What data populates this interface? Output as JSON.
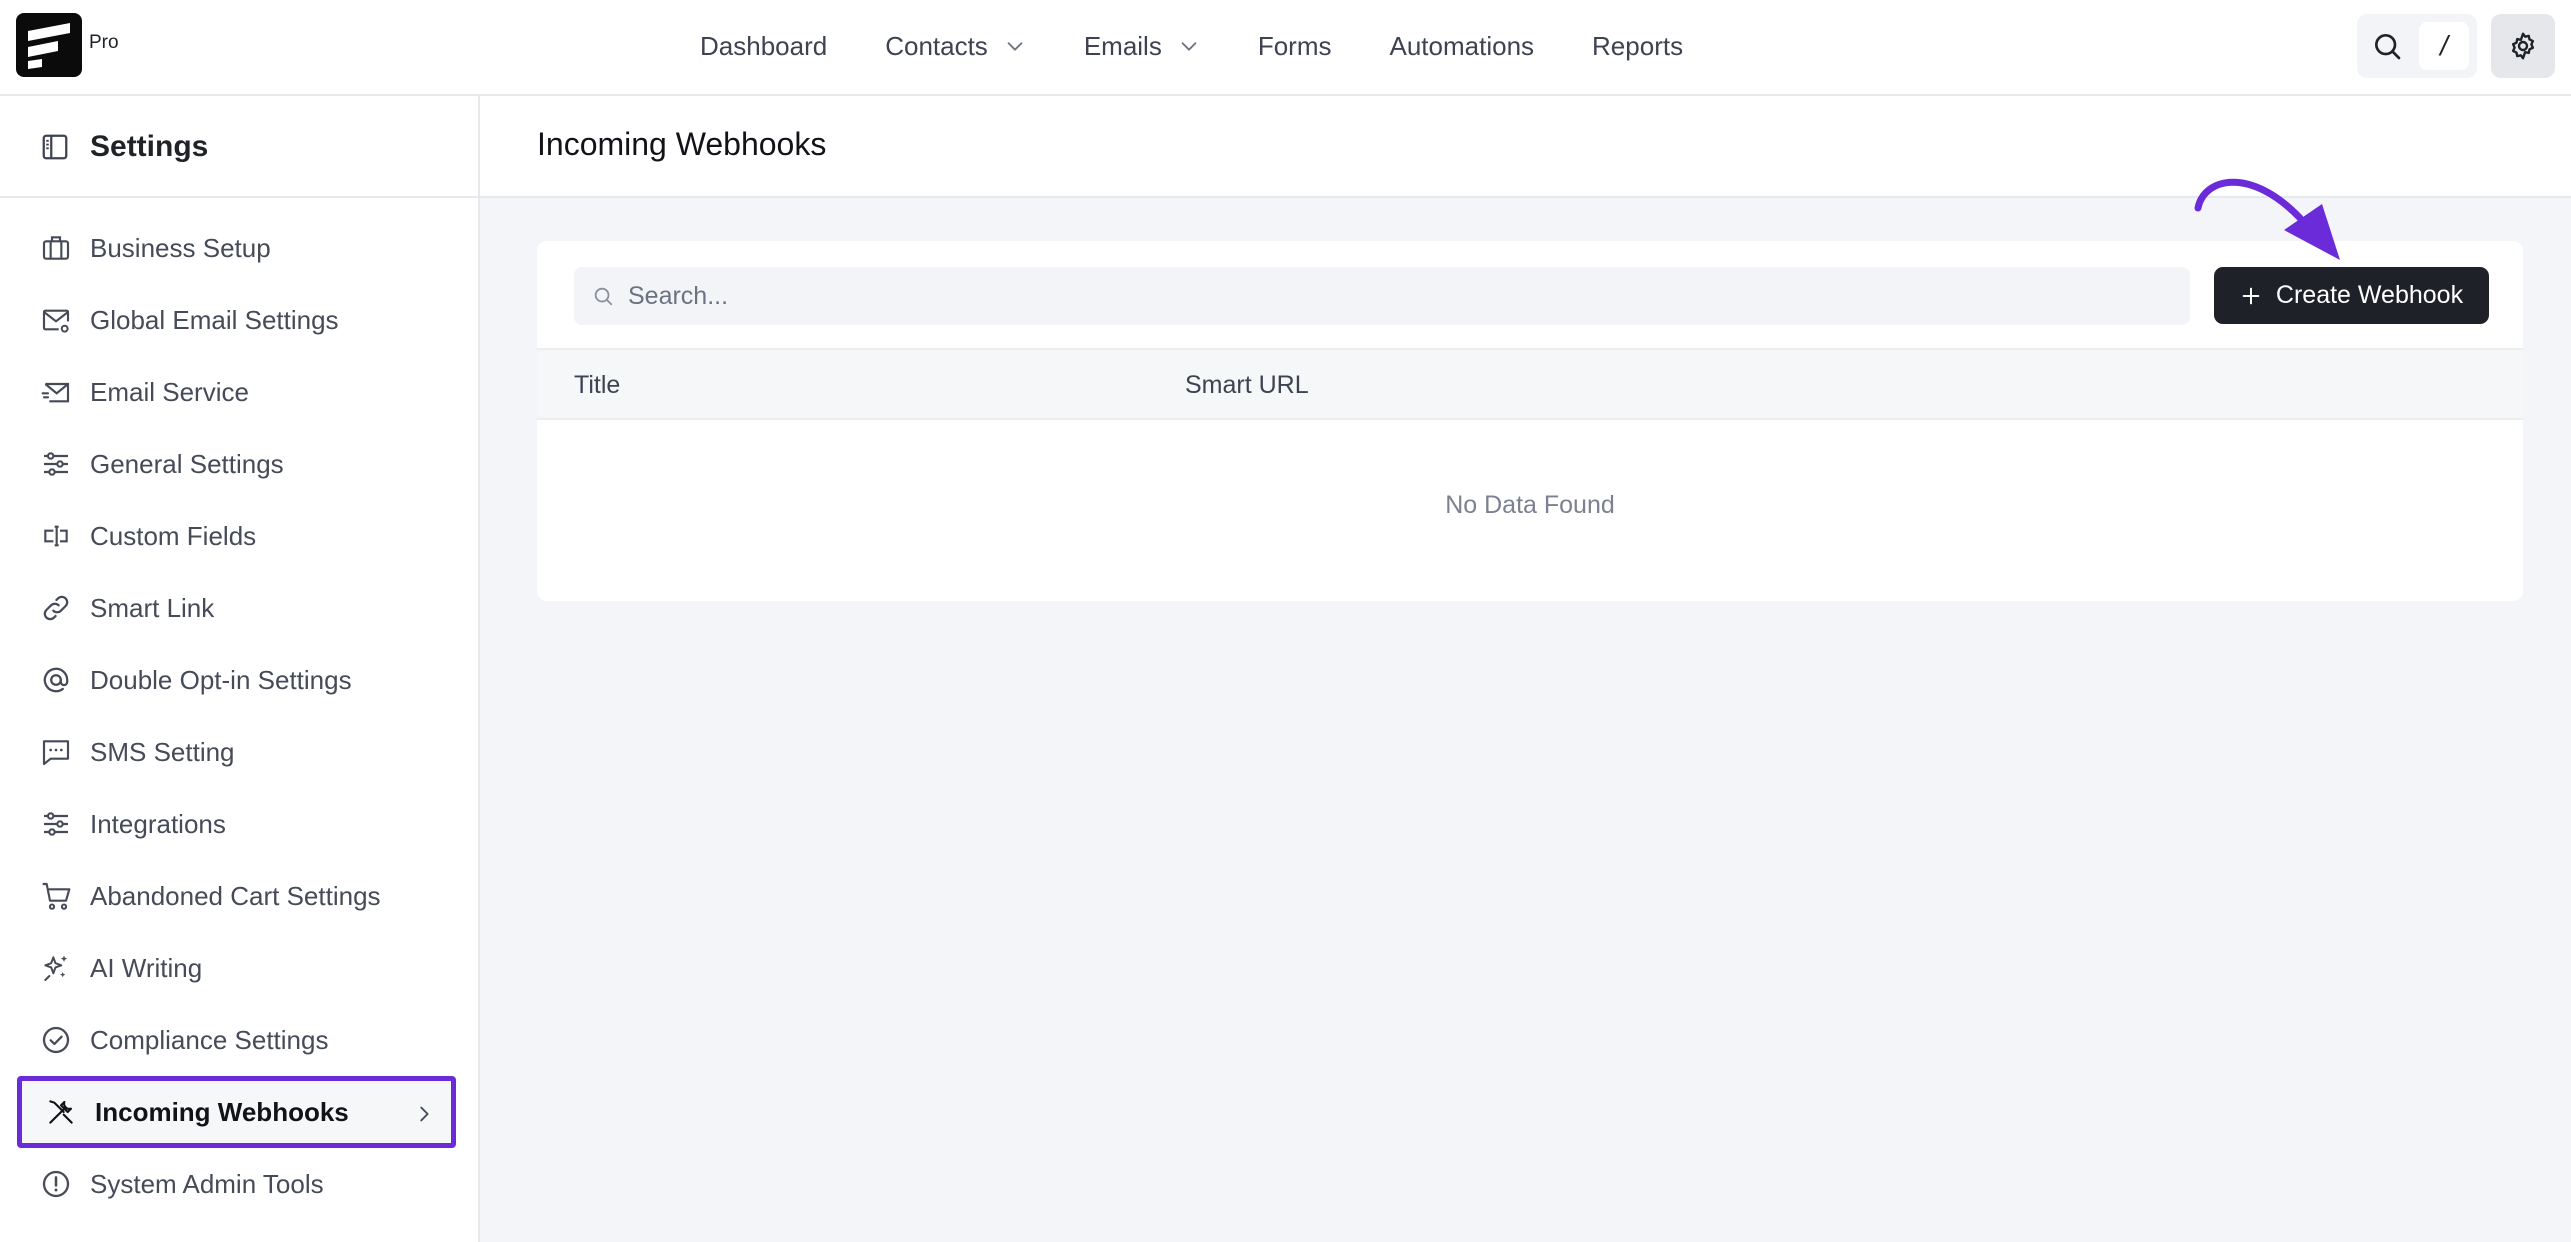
{
  "brand": {
    "badge": "Pro"
  },
  "nav": {
    "items": [
      {
        "label": "Dashboard",
        "has_dropdown": false
      },
      {
        "label": "Contacts",
        "has_dropdown": true
      },
      {
        "label": "Emails",
        "has_dropdown": true
      },
      {
        "label": "Forms",
        "has_dropdown": false
      },
      {
        "label": "Automations",
        "has_dropdown": false
      },
      {
        "label": "Reports",
        "has_dropdown": false
      }
    ],
    "search_shortcut": "/",
    "icons": {
      "search": "search-icon",
      "settings": "gear-icon"
    }
  },
  "sidebar": {
    "title": "Settings",
    "items": [
      {
        "label": "Business Setup",
        "icon": "briefcase-icon"
      },
      {
        "label": "Global Email Settings",
        "icon": "mail-gear-icon"
      },
      {
        "label": "Email Service",
        "icon": "mail-send-icon"
      },
      {
        "label": "General Settings",
        "icon": "sliders-icon"
      },
      {
        "label": "Custom Fields",
        "icon": "text-cursor-input-icon"
      },
      {
        "label": "Smart Link",
        "icon": "link-icon"
      },
      {
        "label": "Double Opt-in Settings",
        "icon": "at-sign-icon"
      },
      {
        "label": "SMS Setting",
        "icon": "message-dots-icon"
      },
      {
        "label": "Integrations",
        "icon": "sliders-icon"
      },
      {
        "label": "Abandoned Cart Settings",
        "icon": "cart-icon"
      },
      {
        "label": "AI Writing",
        "icon": "sparkles-icon"
      },
      {
        "label": "Compliance Settings",
        "icon": "check-circle-icon"
      },
      {
        "label": "Incoming Webhooks",
        "icon": "tools-icon",
        "active": true
      },
      {
        "label": "System Admin Tools",
        "icon": "alert-circle-icon"
      }
    ]
  },
  "main": {
    "page_title": "Incoming Webhooks",
    "search": {
      "placeholder": "Search...",
      "value": ""
    },
    "create_button": "Create Webhook",
    "table": {
      "columns": [
        "Title",
        "Smart URL"
      ],
      "empty_text": "No Data Found"
    }
  },
  "colors": {
    "accent_highlight": "#6b2bd9",
    "primary_button": "#1f2129",
    "page_background": "#f4f5f9"
  }
}
